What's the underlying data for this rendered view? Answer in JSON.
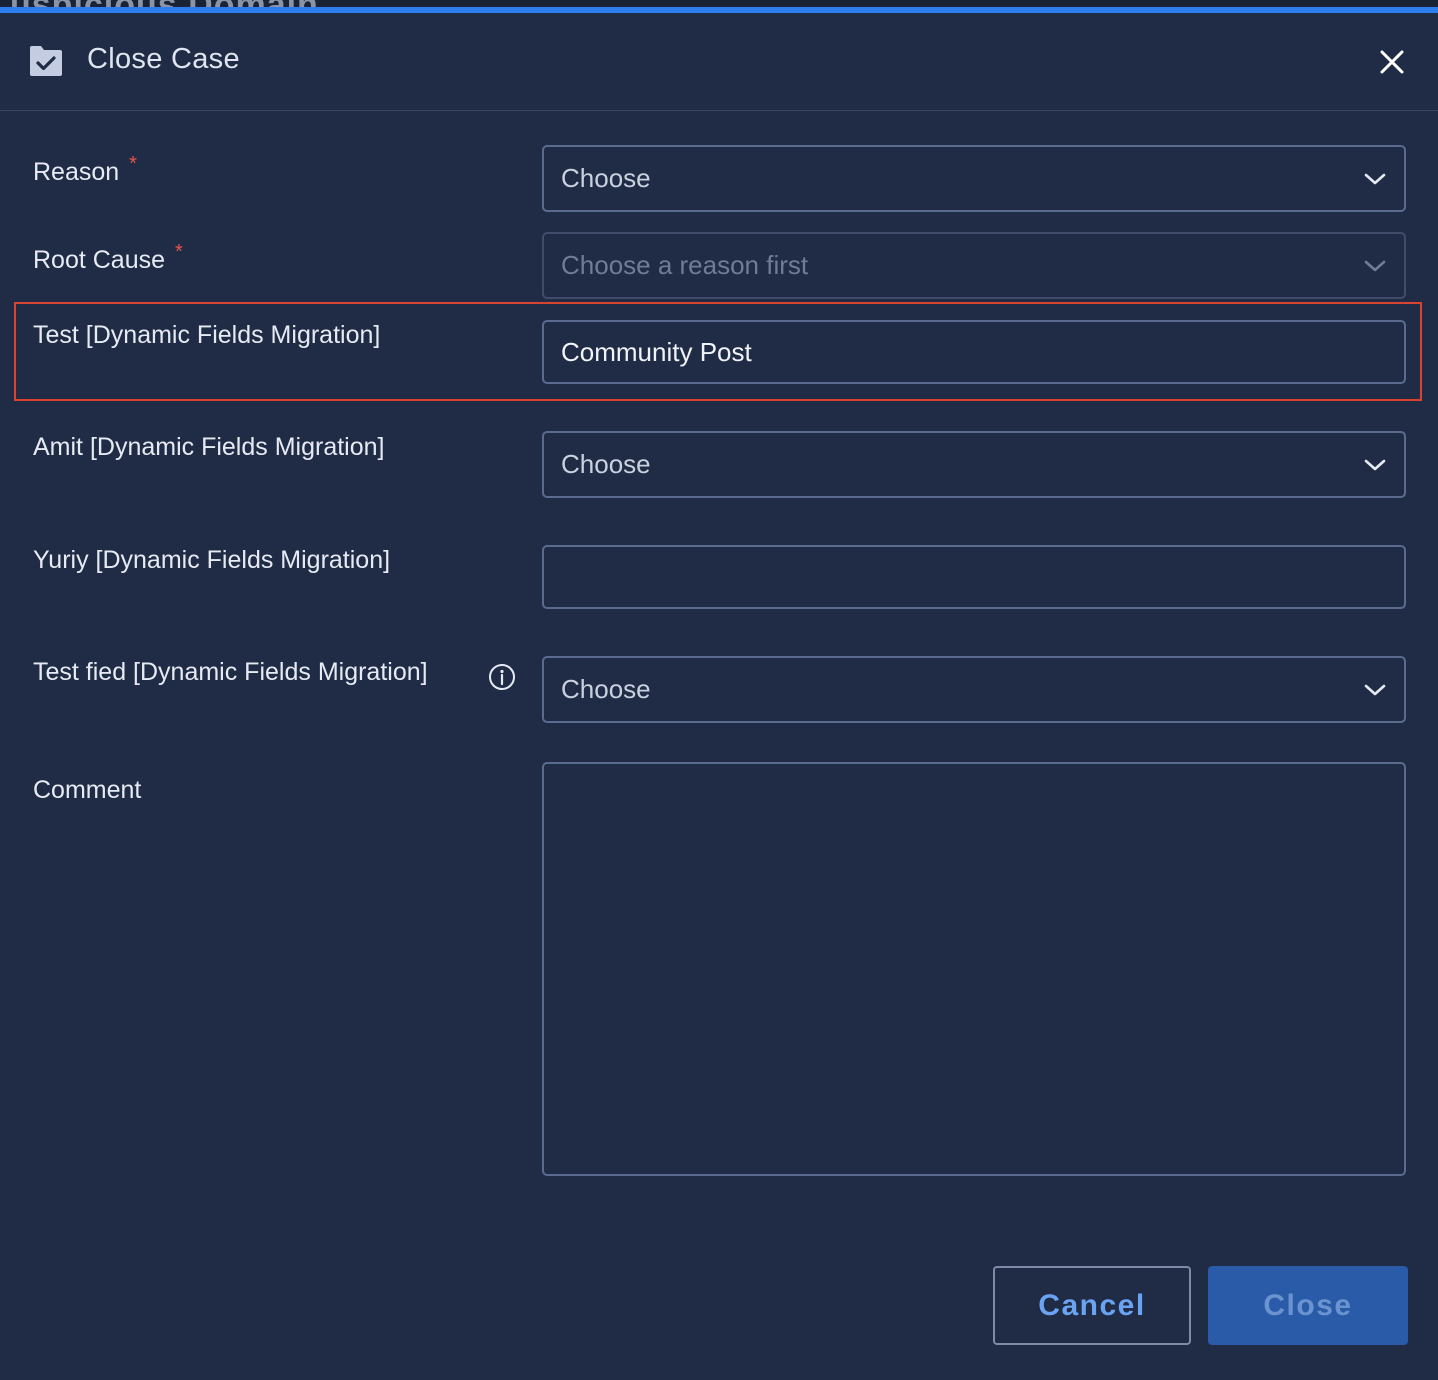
{
  "background": {
    "title_text": "uspicious Domain"
  },
  "dialog": {
    "title": "Close Case",
    "close_icon": "close-icon",
    "title_icon": "folder-check-icon"
  },
  "fields": {
    "reason": {
      "label": "Reason",
      "required_marker": "*",
      "value": "Choose"
    },
    "root_cause": {
      "label": "Root Cause",
      "required_marker": "*",
      "placeholder": "Choose a reason first"
    },
    "test_dynamic": {
      "label": "Test [Dynamic Fields Migration]",
      "value": "Community Post"
    },
    "amit_dynamic": {
      "label": "Amit [Dynamic Fields Migration]",
      "value": "Choose"
    },
    "yuriy_dynamic": {
      "label": "Yuriy [Dynamic Fields Migration]",
      "value": ""
    },
    "test_fied_dynamic": {
      "label": "Test fied [Dynamic Fields Migration]",
      "value": "Choose",
      "info_icon": "info-icon"
    },
    "comment": {
      "label": "Comment",
      "value": ""
    }
  },
  "buttons": {
    "cancel": "Cancel",
    "close": "Close"
  },
  "colors": {
    "background": "#202b45",
    "accent": "#2f7ef0",
    "required": "#e8544b",
    "highlight": "#d9432f",
    "primary_button": "#2a5ba8",
    "link_blue": "#6aa3f2"
  }
}
